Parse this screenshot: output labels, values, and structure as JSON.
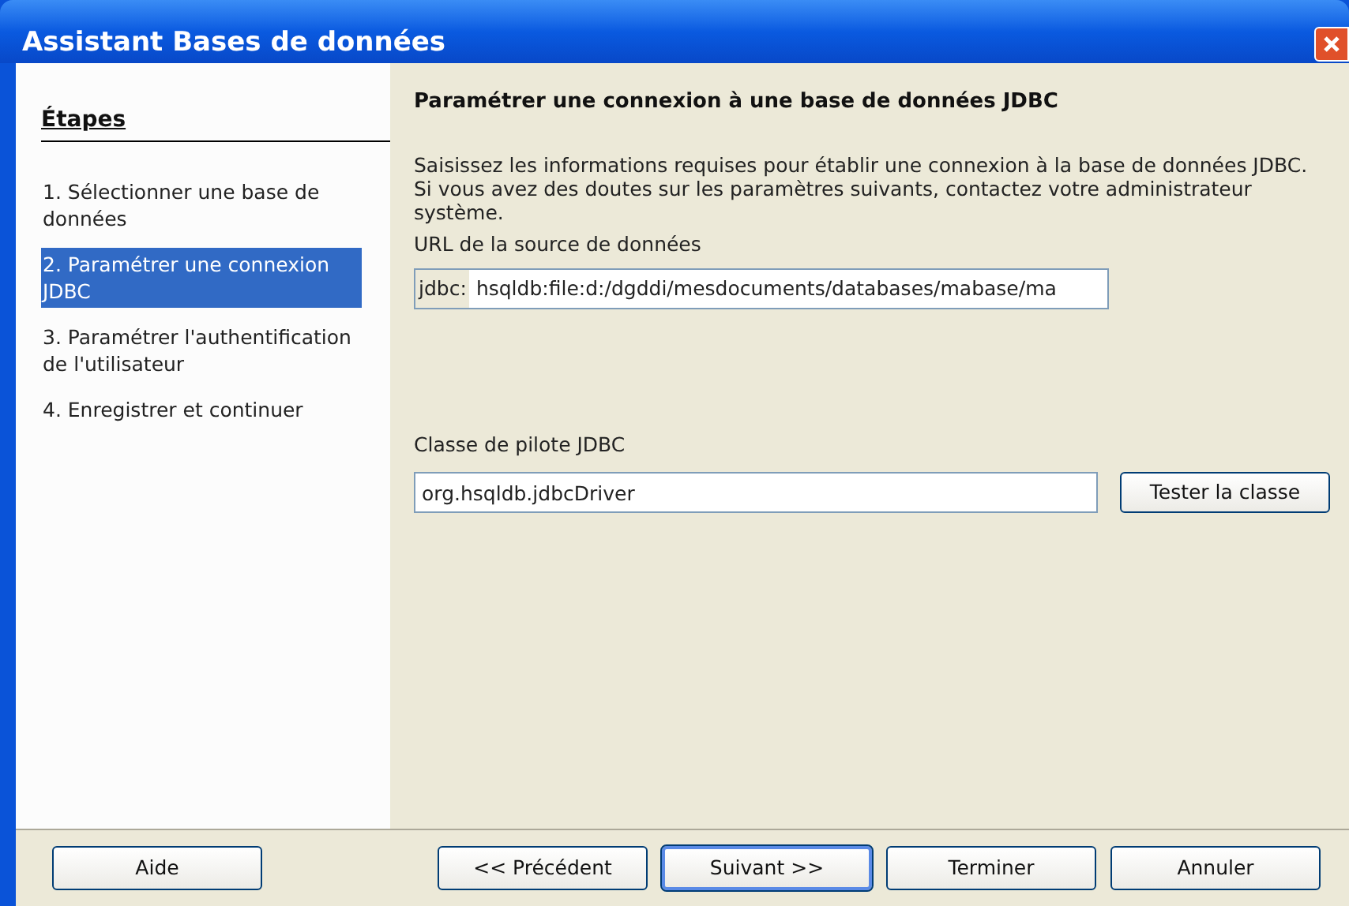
{
  "window": {
    "title": "Assistant Bases de données"
  },
  "sidebar": {
    "heading": "Étapes",
    "steps": [
      {
        "label": "1. Sélectionner une base de données",
        "selected": false
      },
      {
        "label": "2. Paramétrer une connexion JDBC",
        "selected": true
      },
      {
        "label": "3. Paramétrer l'authentification de l'utilisateur",
        "selected": false
      },
      {
        "label": "4. Enregistrer et continuer",
        "selected": false
      }
    ]
  },
  "page": {
    "heading": "Paramétrer une connexion à une base de données JDBC",
    "intro": [
      "Saisissez les informations requises pour établir une connexion à la base de données JDBC.",
      "Si vous avez des doutes sur les paramètres suivants, contactez votre administrateur système."
    ],
    "url_label": "URL de la source de données",
    "url_prefix": "jdbc:",
    "url_value": "hsqldb:file:d:/dgddi/mesdocuments/databases/mabase/ma",
    "driver_label": "Classe de pilote JDBC",
    "driver_value": "org.hsqldb.jdbcDriver",
    "test_button": "Tester la classe"
  },
  "footer": {
    "help_button": "Aide",
    "nav_buttons": [
      {
        "label": "<< Précédent",
        "default": false
      },
      {
        "label": "Suivant >>",
        "default": true
      },
      {
        "label": "Terminer",
        "default": false
      },
      {
        "label": "Annuler",
        "default": false
      }
    ]
  }
}
